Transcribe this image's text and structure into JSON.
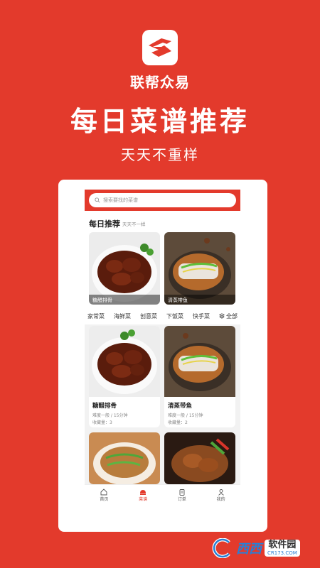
{
  "brand": {
    "name": "联帮众易"
  },
  "hero": {
    "headline": "每日菜谱推荐",
    "subline": "天天不重样"
  },
  "app": {
    "search": {
      "placeholder": "搜索要找的菜谱"
    },
    "daily": {
      "title": "每日推荐",
      "subtitle": "天天不一样",
      "cards": [
        {
          "label": "糖醋排骨"
        },
        {
          "label": "清蒸带鱼"
        }
      ]
    },
    "categories": [
      "家常菜",
      "海鲜菜",
      "创意菜",
      "下饭菜",
      "快手菜",
      "全部"
    ],
    "recipes": [
      {
        "name": "糖醋排骨",
        "meta": "难度一般 / 15分钟",
        "favorites": "收藏量：3"
      },
      {
        "name": "清蒸带鱼",
        "meta": "难度一般 / 15分钟",
        "favorites": "收藏量：2"
      }
    ],
    "tabbar": [
      {
        "label": "首页",
        "icon": "home-icon"
      },
      {
        "label": "菜谱",
        "icon": "chef-hat-icon",
        "active": true
      },
      {
        "label": "订单",
        "icon": "clipboard-icon"
      },
      {
        "label": "我的",
        "icon": "user-icon"
      }
    ]
  },
  "watermark": {
    "name": "西西",
    "site": "软件园",
    "url": "CR173.COM"
  },
  "colors": {
    "brand_red": "#e33a2c",
    "watermark_blue": "#2a7fd4"
  }
}
